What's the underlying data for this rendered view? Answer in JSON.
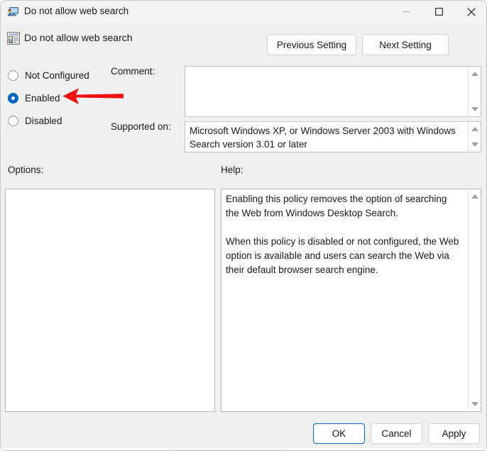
{
  "window": {
    "title": "Do not allow web search",
    "title_icon": "policy-monitor-icon",
    "controls": {
      "minimize": "minimize-icon",
      "maximize": "maximize-icon",
      "close": "close-icon"
    }
  },
  "header": {
    "policy_icon": "policy-setting-icon",
    "policy_name": "Do not allow web search",
    "previous_setting": "Previous Setting",
    "next_setting": "Next Setting"
  },
  "state": {
    "options": [
      {
        "label": "Not Configured",
        "selected": false
      },
      {
        "label": "Enabled",
        "selected": true
      },
      {
        "label": "Disabled",
        "selected": false
      }
    ]
  },
  "comment": {
    "label": "Comment:",
    "value": ""
  },
  "supported": {
    "label": "Supported on:",
    "value": "Microsoft Windows XP, or Windows Server 2003 with Windows Search version 3.01 or later"
  },
  "options_pane": {
    "label": "Options:",
    "value": ""
  },
  "help_pane": {
    "label": "Help:",
    "value": "Enabling this policy removes the option of searching the Web from Windows Desktop Search.\n\nWhen this policy is disabled or not configured, the Web option is available and users can search the Web via their default browser search engine."
  },
  "footer": {
    "ok": "OK",
    "cancel": "Cancel",
    "apply": "Apply"
  },
  "annotation": {
    "type": "arrow",
    "direction": "left",
    "color": "#f01010",
    "points_at": "Enabled"
  },
  "colors": {
    "accent": "#0067c0",
    "window_bg": "#f0f0f0",
    "titlebar_bg": "#f3f3f3",
    "field_bg": "#ffffff",
    "text": "#1a1a1a",
    "annotation_red": "#f01010"
  }
}
